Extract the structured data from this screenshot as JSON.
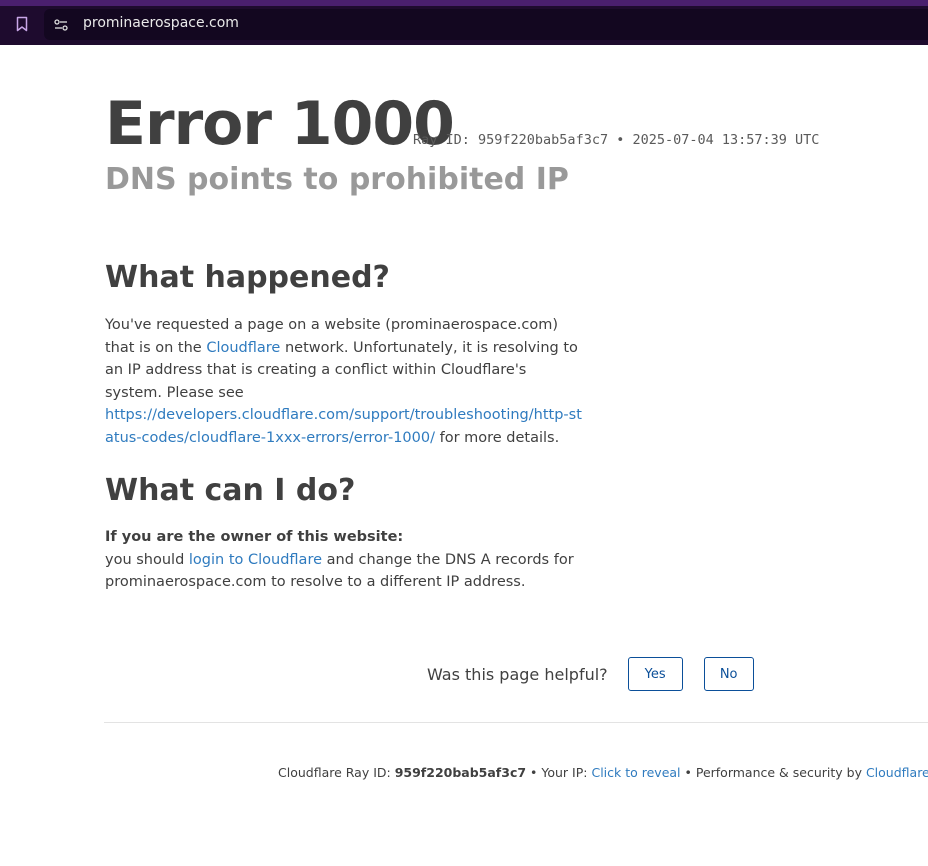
{
  "browser": {
    "url": "prominaerospace.com"
  },
  "error": {
    "title": "Error 1000",
    "ray_prefix": "Ray ID: ",
    "ray_id": "959f220bab5af3c7",
    "separator": " • ",
    "timestamp": "2025-07-04 13:57:39 UTC",
    "subtitle": "DNS points to prohibited IP"
  },
  "what_happened": {
    "heading": "What happened?",
    "text_1": "You've requested a page on a website (prominaerospace.com) that is on the ",
    "link_cloudflare": "Cloudflare",
    "text_2": " network. Unfortunately, it is resolving to an IP address that is creating a conflict within Cloudflare's system. Please see ",
    "link_docs": "https://developers.cloudflare.com/support/troubleshooting/http-status-codes/cloudflare-1xxx-errors/error-1000/",
    "text_3": " for more details."
  },
  "what_can_i_do": {
    "heading": "What can I do?",
    "owner_label": "If you are the owner of this website:",
    "text_1": "you should ",
    "link_login": "login to Cloudflare",
    "text_2": " and change the DNS A records for prominaerospace.com to resolve to a different IP address."
  },
  "feedback": {
    "question": "Was this page helpful?",
    "yes_label": "Yes",
    "no_label": "No"
  },
  "footer": {
    "ray_label": "Cloudflare Ray ID: ",
    "ray_id": "959f220bab5af3c7",
    "sep_1": " • ",
    "ip_label": "Your IP: ",
    "ip_link": "Click to reveal",
    "sep_2": " • ",
    "perf_label": "Performance & security by ",
    "cloudflare_link": "Cloudflare"
  },
  "colors": {
    "link": "#2f7bbf",
    "button_border": "#0b4f99",
    "browser_bar": "#1e0b2e"
  }
}
